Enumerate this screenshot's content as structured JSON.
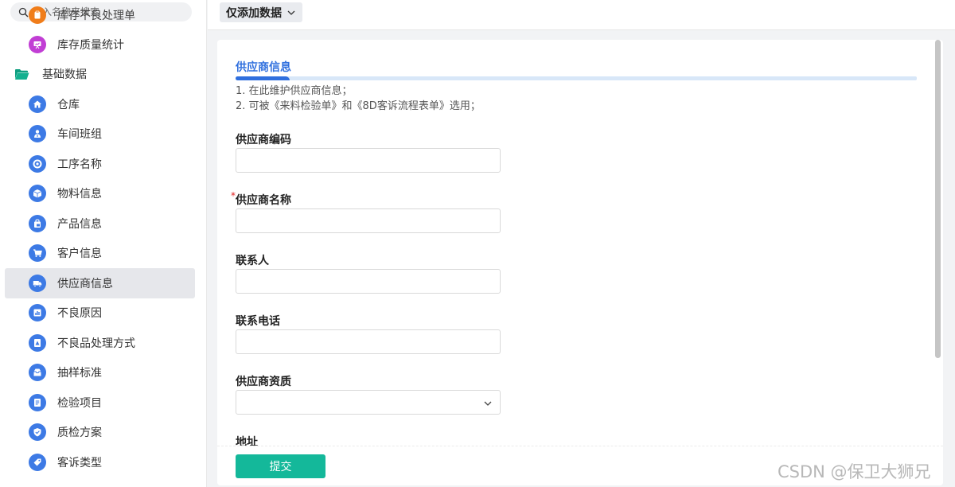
{
  "search": {
    "placeholder": "输入名称来搜索"
  },
  "sidebar": {
    "clipped_item": {
      "label": "库存不良处理单",
      "icon": "clipboard-icon",
      "color": "#f07d1a"
    },
    "stats_item": {
      "label": "库存质量统计",
      "icon": "presentation-icon",
      "color": "#c13ed4"
    },
    "group": {
      "label": "基础数据",
      "icon": "folder-open-icon",
      "color": "#13b08f"
    },
    "items": [
      {
        "label": "仓库",
        "icon": "home-icon"
      },
      {
        "label": "车间班组",
        "icon": "worker-icon"
      },
      {
        "label": "工序名称",
        "icon": "target-icon"
      },
      {
        "label": "物料信息",
        "icon": "box-icon"
      },
      {
        "label": "产品信息",
        "icon": "bag-icon"
      },
      {
        "label": "客户信息",
        "icon": "cart-icon"
      },
      {
        "label": "供应商信息",
        "icon": "truck-icon",
        "active": true
      },
      {
        "label": "不良原因",
        "icon": "chart-icon"
      },
      {
        "label": "不良品处理方式",
        "icon": "alert-doc-icon"
      },
      {
        "label": "抽样标准",
        "icon": "inbox-icon"
      },
      {
        "label": "检验项目",
        "icon": "document-icon"
      },
      {
        "label": "质检方案",
        "icon": "shield-check-icon"
      },
      {
        "label": "客诉类型",
        "icon": "tag-icon"
      }
    ],
    "accent": "#3d7ae5"
  },
  "toolbar": {
    "add_mode": "仅添加数据"
  },
  "form": {
    "section_title": "供应商信息",
    "notes": [
      "1. 在此维护供应商信息；",
      "2. 可被《来料检验单》和《8D客诉流程表单》选用；"
    ],
    "fields": {
      "code": {
        "label": "供应商编码",
        "value": ""
      },
      "name": {
        "label": "供应商名称",
        "value": "",
        "required_mark": "*"
      },
      "contact": {
        "label": "联系人",
        "value": ""
      },
      "phone": {
        "label": "联系电话",
        "value": ""
      },
      "qualification": {
        "label": "供应商资质",
        "value": ""
      },
      "address": {
        "label": "地址"
      }
    },
    "submit_label": "提交",
    "accent": "#2f6fde",
    "button_color": "#14b89a"
  },
  "watermark": "CSDN @保卫大狮兄"
}
